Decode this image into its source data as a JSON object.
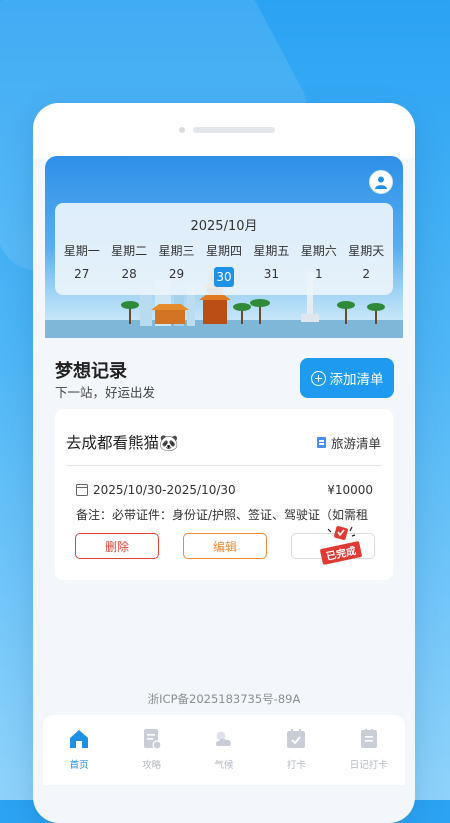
{
  "calendar": {
    "title": "2025/10月",
    "weekdays": [
      "星期一",
      "星期二",
      "星期三",
      "星期四",
      "星期五",
      "星期六",
      "星期天"
    ],
    "days": [
      "27",
      "28",
      "29",
      "30",
      "31",
      "1",
      "2"
    ],
    "selected_day": "30"
  },
  "section": {
    "title": "梦想记录",
    "subtitle": "下一站，好运出发",
    "add_button": "添加清单"
  },
  "card": {
    "title": "去成都看熊猫🐼",
    "tag": "旅游清单",
    "date_range": "2025/10/30-2025/10/30",
    "price": "¥10000",
    "note": "备注：必带证件：身份证/护照、签证、驾驶证（如需租",
    "delete_label": "删除",
    "edit_label": "编辑",
    "stamp_text": "已完成"
  },
  "footer": {
    "icp": "浙ICP备2025183735号-89A"
  },
  "tabbar": {
    "items": [
      {
        "label": "首页",
        "icon": "home-icon",
        "active": true
      },
      {
        "label": "攻略",
        "icon": "guide-icon",
        "active": false
      },
      {
        "label": "气候",
        "icon": "weather-icon",
        "active": false
      },
      {
        "label": "打卡",
        "icon": "checkin-icon",
        "active": false
      },
      {
        "label": "日记打卡",
        "icon": "diary-icon",
        "active": false
      }
    ]
  },
  "colors": {
    "accent": "#1e90e6",
    "delete": "#e0443a",
    "edit": "#f08b3a",
    "stamp": "#e03a35"
  }
}
